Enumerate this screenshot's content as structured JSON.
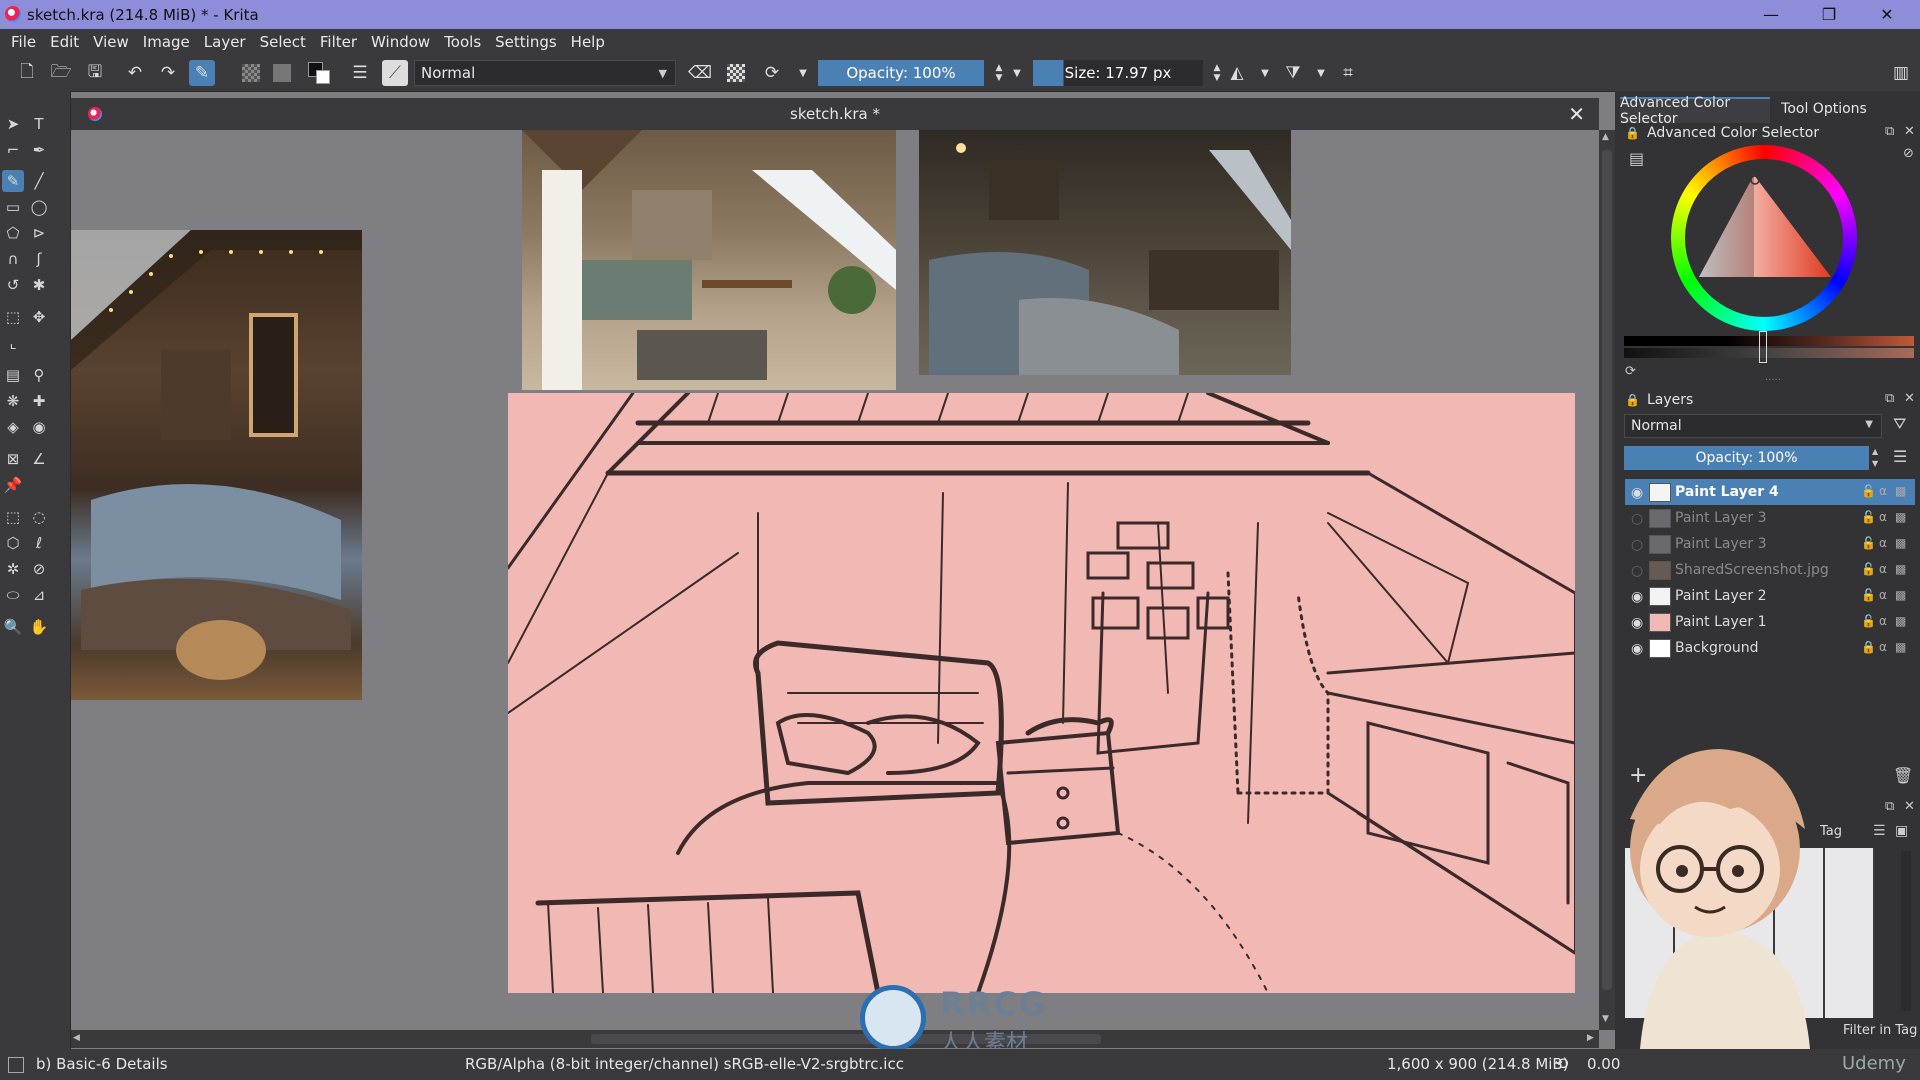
{
  "window": {
    "title": "sketch.kra (214.8 MiB)  * - Krita",
    "minimize": "—",
    "restore": "❐",
    "close": "✕"
  },
  "menu": [
    "File",
    "Edit",
    "View",
    "Image",
    "Layer",
    "Select",
    "Filter",
    "Window",
    "Tools",
    "Settings",
    "Help"
  ],
  "toolbar": {
    "blend_mode": "Normal",
    "opacity": "Opacity: 100%",
    "size": "Size: 17.97 px"
  },
  "document": {
    "tab_title": "sketch.kra *",
    "close": "✕"
  },
  "dock": {
    "tabs": [
      "Advanced Color Selector",
      "Tool Options"
    ],
    "color_panel_title": "Advanced Color Selector",
    "layers_title": "Layers",
    "layers_blend": "Normal",
    "layers_opacity": "Opacity:  100%",
    "layers": [
      {
        "name": "Paint Layer 4",
        "visible": true,
        "active": true
      },
      {
        "name": "Paint Layer 3",
        "visible": false,
        "active": false
      },
      {
        "name": "Paint Layer 3",
        "visible": false,
        "active": false
      },
      {
        "name": "SharedScreenshot.jpg",
        "visible": false,
        "active": false
      },
      {
        "name": "Paint Layer 2",
        "visible": true,
        "active": false
      },
      {
        "name": "Paint Layer 1",
        "visible": true,
        "active": false
      },
      {
        "name": "Background",
        "visible": true,
        "active": false
      }
    ],
    "brush_tag": "Tag",
    "filter_in_tag": "Filter in Tag"
  },
  "status": {
    "brush_preset": "b) Basic-6 Details",
    "color_profile": "RGB/Alpha (8-bit integer/channel)  sRGB-elle-V2-srgbtrc.icc",
    "image_size": "1,600 x 900 (214.8 MiB)",
    "rotation": "0.00"
  },
  "watermark": {
    "main": "RRCG",
    "sub": "人人素材",
    "udemy": "Udemy"
  },
  "colors": {
    "title_bar": "#8d8dd9",
    "chrome": "#3a3a3d",
    "accent": "#4b80b4",
    "sketch_bg": "#f2b8b3"
  }
}
